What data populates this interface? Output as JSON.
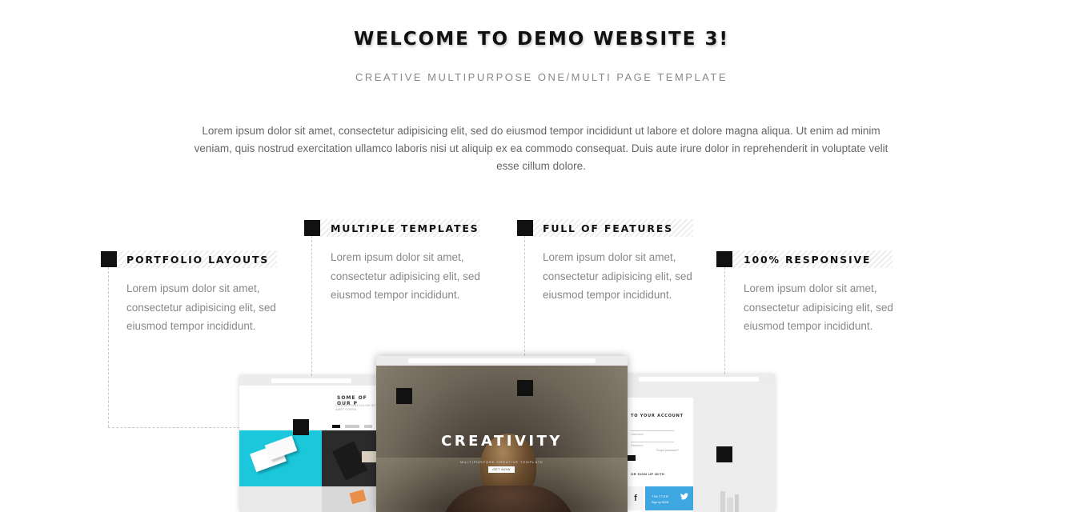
{
  "header": {
    "title": "WELCOME TO DEMO WEBSITE 3!",
    "subtitle": "CREATIVE MULTIPURPOSE ONE/MULTI PAGE TEMPLATE",
    "intro": "Lorem ipsum dolor sit amet, consectetur adipisicing elit, sed do eiusmod tempor incididunt ut labore et dolore magna aliqua. Ut enim ad minim veniam, quis nostrud exercitation ullamco laboris nisi ut aliquip ex ea commodo consequat. Duis aute irure dolor in reprehenderit in voluptate velit esse cillum dolore."
  },
  "features": [
    {
      "title": "PORTFOLIO LAYOUTS",
      "text": "Lorem ipsum dolor sit amet, consectetur adipisicing elit, sed eiusmod tempor incididunt."
    },
    {
      "title": "MULTIPLE TEMPLATES",
      "text": "Lorem ipsum dolor sit amet, consectetur adipisicing elit, sed eiusmod tempor incididunt."
    },
    {
      "title": "FULL OF FEATURES",
      "text": "Lorem ipsum dolor sit amet, consectetur adipisicing elit, sed eiusmod tempor incididunt."
    },
    {
      "title": "100% RESPONSIVE",
      "text": "Lorem ipsum dolor sit amet, consectetur adipisicing elit, sed eiusmod tempor incididunt."
    }
  ],
  "mockups": {
    "left_heading": "SOME OF OUR P",
    "left_sub": "LOREM IPSUM DOLOR SIT AMET CONSE",
    "hero_title": "CREATIVITY",
    "hero_sub": "MULTIPURPOSE CREATIVE TEMPLATE",
    "hero_button": "GET NOW",
    "login_title": "TO YOUR ACCOUNT",
    "login_field_1": "Username",
    "login_field_2": "Password",
    "forgot": "Forgot password?",
    "social_label": "OR SIGN UP WITH",
    "facebook_glyph": "f",
    "twitter_label": "TWITTER",
    "twitter_sub": "Sign up NOW"
  },
  "colors": {
    "square": "#111111",
    "cyan_tile": "#1bc7db",
    "twitter": "#3ea7e2"
  }
}
